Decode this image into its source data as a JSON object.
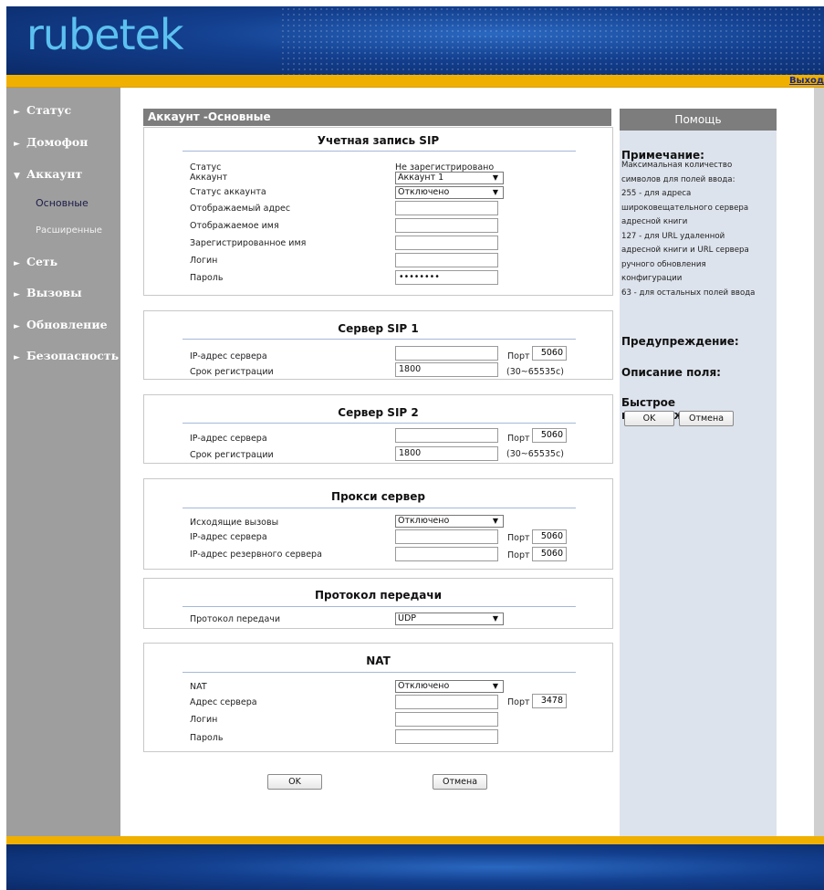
{
  "header": {
    "logo": "rubetek",
    "logout": "Выход"
  },
  "sidebar": {
    "items": [
      {
        "label": "Статус"
      },
      {
        "label": "Домофон"
      },
      {
        "label": "Аккаунт"
      },
      {
        "label": "Основные"
      },
      {
        "label": "Расширенные"
      },
      {
        "label": "Сеть"
      },
      {
        "label": "Вызовы"
      },
      {
        "label": "Обновление"
      },
      {
        "label": "Безопасность"
      }
    ]
  },
  "page_title": "Аккаунт -Основные",
  "sip_account": {
    "title": "Учетная запись SIP",
    "status_label": "Статус",
    "status_value": "Не зарегистрировано",
    "account_label": "Аккаунт",
    "account_value": "Аккаунт 1",
    "account_status_label": "Статус аккаунта",
    "account_status_value": "Отключено",
    "display_address_label": "Отображаемый адрес",
    "display_address_value": "",
    "display_name_label": "Отображаемое имя",
    "display_name_value": "",
    "registered_name_label": "Зарегистрированное имя",
    "registered_name_value": "",
    "login_label": "Логин",
    "login_value": "",
    "password_label": "Пароль",
    "password_value": "••••••••"
  },
  "sip_server1": {
    "title": "Сервер SIP 1",
    "ip_label": "IP-адрес сервера",
    "ip_value": "",
    "port_label": "Порт",
    "port_value": "5060",
    "reg_label": "Срок регистрации",
    "reg_value": "1800",
    "reg_range": "(30~65535с)"
  },
  "sip_server2": {
    "title": "Сервер SIP 2",
    "ip_label": "IP-адрес сервера",
    "ip_value": "",
    "port_label": "Порт",
    "port_value": "5060",
    "reg_label": "Срок регистрации",
    "reg_value": "1800",
    "reg_range": "(30~65535с)"
  },
  "proxy": {
    "title": "Прокси сервер",
    "outgoing_label": "Исходящие вызовы",
    "outgoing_value": "Отключено",
    "ip_label": "IP-адрес сервера",
    "ip_value": "",
    "port_label": "Порт",
    "port_value": "5060",
    "backup_ip_label": "IP-адрес резервного сервера",
    "backup_ip_value": "",
    "backup_port_label": "Порт",
    "backup_port_value": "5060"
  },
  "transport": {
    "title": "Протокол передачи",
    "label": "Протокол передачи",
    "value": "UDP"
  },
  "nat": {
    "title": "NAT",
    "nat_label": "NAT",
    "nat_value": "Отключено",
    "server_label": "Адрес сервера",
    "server_value": "",
    "port_label": "Порт",
    "port_value": "3478",
    "login_label": "Логин",
    "login_value": "",
    "password_label": "Пароль",
    "password_value": ""
  },
  "actions": {
    "ok": "OK",
    "cancel": "Отмена"
  },
  "help": {
    "header": "Помощь",
    "note_title": "Примечание:",
    "note_text": "Максимальная количество\nсимволов для полей ввода:\n255 - для адреса\nшироковещательного сервера\nадресной книги\n127 - для URL удаленной\nадресной книги и URL сервера\nручного обновления\nконфигурации\n63 - для остальных полей ввода",
    "warning_title": "Предупреждение:",
    "field_desc_title": "Описание поля:",
    "quick_confirm_title": "Быстрое подтверждение",
    "ok": "OK",
    "cancel": "Отмена"
  },
  "colors": {
    "accent": "#f0b000",
    "header_blue": "#133f8e",
    "sidebar": "#9e9e9e",
    "panel_head": "#7d7d7d"
  }
}
